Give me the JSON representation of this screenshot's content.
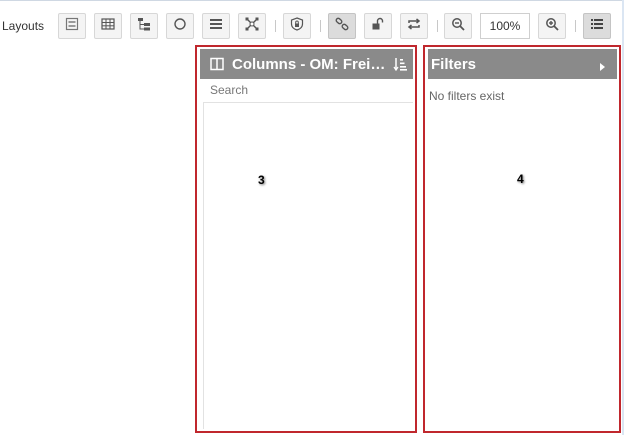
{
  "toolbar": {
    "layouts_label": "Layouts",
    "zoom_value": "100%",
    "buttons": [
      {
        "icon": "layout-form-icon"
      },
      {
        "icon": "table-grid-icon"
      },
      {
        "icon": "tree-hierarchy-icon"
      },
      {
        "icon": "circle-icon"
      },
      {
        "icon": "list-lines-icon"
      },
      {
        "icon": "cross-network-icon"
      },
      {
        "icon": "shield-lock-icon"
      },
      {
        "icon": "link-chain-icon",
        "active": true
      },
      {
        "icon": "unlock-padlock-icon"
      },
      {
        "icon": "refresh-loop-icon"
      },
      {
        "icon": "zoom-out-icon"
      },
      {
        "icon": "zoom-in-icon"
      },
      {
        "icon": "list-panel-icon",
        "active": true
      }
    ]
  },
  "columns_panel": {
    "title": "Columns - OM: Frei…",
    "search_placeholder": "Search",
    "annotation": "3"
  },
  "filters_panel": {
    "title": "Filters",
    "empty_text": "No filters exist",
    "annotation": "4"
  },
  "colors": {
    "panel_header_bg": "#8a8a8a",
    "annotation_border": "#c0272d",
    "toolbar_button_bg": "#f4f4f4"
  }
}
